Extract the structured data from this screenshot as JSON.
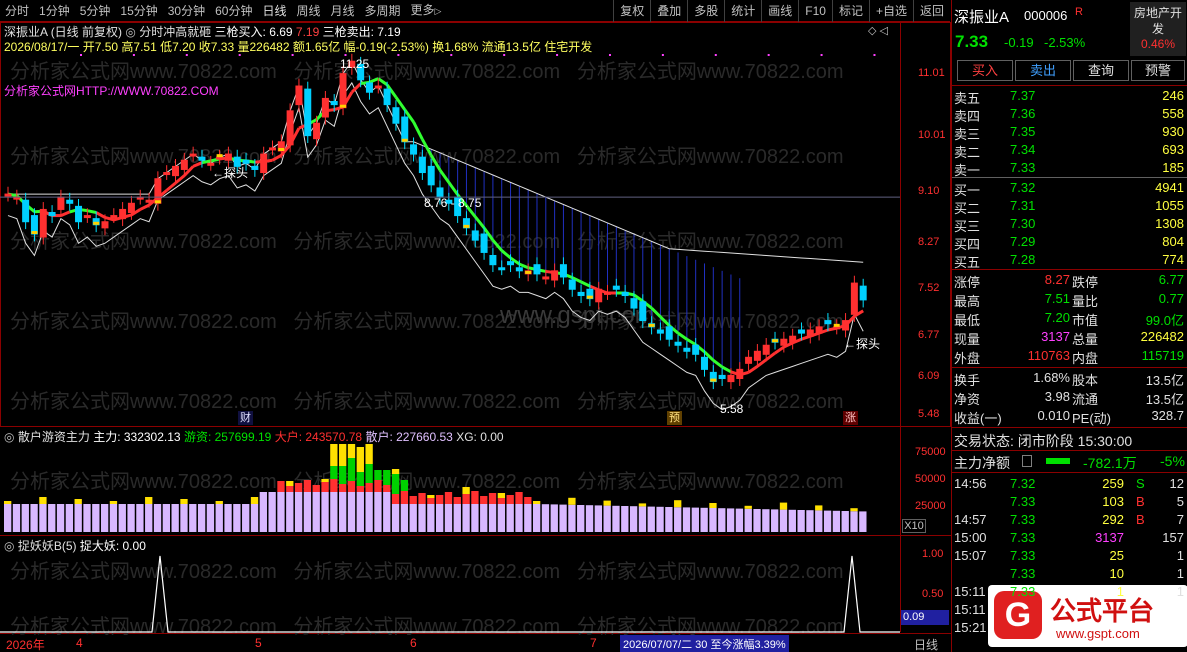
{
  "toolbar": {
    "periods": [
      "分时",
      "1分钟",
      "5分钟",
      "15分钟",
      "30分钟",
      "60分钟",
      "日线",
      "周线",
      "月线",
      "多周期",
      "更多"
    ],
    "more_arrow": "▷",
    "buttons": [
      "复权",
      "叠加",
      "多股",
      "统计",
      "画线",
      "F10",
      "标记",
      "+自选",
      "返回"
    ]
  },
  "main_chart": {
    "stock_name": "深振业A",
    "period_label": "(日线 前复权)",
    "indicator_name": "分时冲高就砸",
    "buy_label": "三枪买入: 6.69",
    "buy_value2": "7.19",
    "sell_label": "三枪卖出: 7.19",
    "info_line": "2026/08/17/一 开7.50 高7.51 低7.20 收7.33 量226482 额1.65亿 幅-0.19(-2.53%) 换1.68% 流通13.5亿 住宅开发",
    "source_text": "分析家公式网HTTP://WWW.70822.COM",
    "high_label": "11.25",
    "low_label": "5.58",
    "band_label": "8.76 - 8.75",
    "tanto_left": "探头",
    "tanto_right": "探头",
    "marker_cai": "财",
    "marker_yu": "预",
    "marker_zhang": "涨",
    "price_ticks": [
      "11.01",
      "10.01",
      "9.10",
      "8.27",
      "7.52",
      "6.77",
      "6.09",
      "5.48"
    ]
  },
  "vol_chart": {
    "title": "散户游资主力",
    "main_label": "主力: 332302.13",
    "youzi_label": "游资: 257699.19",
    "dahu_label": "大户: 243570.78",
    "sanhu_label": "散户: 227660.53",
    "xg_label": "XG: 0.00",
    "ticks": [
      "75000",
      "50000",
      "25000"
    ],
    "unit": "X10"
  },
  "signal_chart": {
    "title": "捉妖妖B(5)",
    "value_label": "捉大妖: 0.00",
    "ticks": [
      "1.00",
      "0.50"
    ],
    "current": "0.09"
  },
  "date_axis": {
    "labels": [
      "2026年",
      "4",
      "5",
      "6",
      "7"
    ],
    "info": "2026/07/07/二 30 至今涨幅3.39%",
    "period": "日线"
  },
  "side": {
    "stock_name": "深振业A",
    "code": "000006",
    "r_badge": "R",
    "sector": "房地产开发",
    "sector_pct": "0.46%",
    "price": "7.33",
    "change": "-0.19",
    "change_pct": "-2.53%",
    "btn_buy": "买入",
    "btn_sell": "卖出",
    "btn_query": "查询",
    "btn_warn": "预警",
    "asks": [
      {
        "label": "卖五",
        "price": "7.37",
        "vol": "246"
      },
      {
        "label": "卖四",
        "price": "7.36",
        "vol": "558"
      },
      {
        "label": "卖三",
        "price": "7.35",
        "vol": "930"
      },
      {
        "label": "卖二",
        "price": "7.34",
        "vol": "693"
      },
      {
        "label": "卖一",
        "price": "7.33",
        "vol": "185"
      }
    ],
    "bids": [
      {
        "label": "买一",
        "price": "7.32",
        "vol": "4941"
      },
      {
        "label": "买二",
        "price": "7.31",
        "vol": "1055"
      },
      {
        "label": "买三",
        "price": "7.30",
        "vol": "1308"
      },
      {
        "label": "买四",
        "price": "7.29",
        "vol": "804"
      },
      {
        "label": "买五",
        "price": "7.28",
        "vol": "774"
      }
    ],
    "stats": [
      {
        "l1": "涨停",
        "v1": "8.27",
        "l2": "跌停",
        "v2": "6.77"
      },
      {
        "l1": "最高",
        "v1": "7.51",
        "l2": "量比",
        "v2": "0.77"
      },
      {
        "l1": "最低",
        "v1": "7.20",
        "l2": "市值",
        "v2": "99.0亿"
      },
      {
        "l1": "现量",
        "v1": "3137",
        "l2": "总量",
        "v2": "226482"
      },
      {
        "l1": "外盘",
        "v1": "110763",
        "l2": "内盘",
        "v2": "115719"
      }
    ],
    "stats2": [
      {
        "l1": "换手",
        "v1": "1.68%",
        "l2": "股本",
        "v2": "13.5亿"
      },
      {
        "l1": "净资",
        "v1": "3.98",
        "l2": "流通",
        "v2": "13.5亿"
      },
      {
        "l1": "收益(一)",
        "v1": "0.010",
        "l2": "PE(动)",
        "v2": "328.7"
      }
    ],
    "trade_state": "交易状态: 闭市阶段 15:30:00",
    "net_label": "主力净额",
    "net_value": "-782.1万",
    "net_pct": "-5%",
    "ticks": [
      {
        "time": "14:56",
        "price": "7.32",
        "vol": "259",
        "bs": "S",
        "n": "12"
      },
      {
        "time": "",
        "price": "7.33",
        "vol": "103",
        "bs": "B",
        "n": "5"
      },
      {
        "time": "14:57",
        "price": "7.33",
        "vol": "292",
        "bs": "B",
        "n": "7"
      },
      {
        "time": "15:00",
        "price": "7.33",
        "vol": "3137",
        "bs": "",
        "n": "157"
      },
      {
        "time": "15:07",
        "price": "7.33",
        "vol": "25",
        "bs": "",
        "n": "1"
      },
      {
        "time": "",
        "price": "7.33",
        "vol": "10",
        "bs": "",
        "n": "1"
      },
      {
        "time": "15:11",
        "price": "7.33",
        "vol": "1",
        "bs": "",
        "n": "1"
      },
      {
        "time": "15:11",
        "price": "",
        "vol": "",
        "bs": "",
        "n": ""
      },
      {
        "time": "15:21",
        "price": "",
        "vol": "",
        "bs": "",
        "n": ""
      }
    ],
    "logo_text": "公式平台",
    "logo_url": "www.gspt.com"
  },
  "colors": {
    "up": "#ff3030",
    "down": "#00e0ff",
    "green": "#00e000",
    "border": "#8b0000"
  }
}
